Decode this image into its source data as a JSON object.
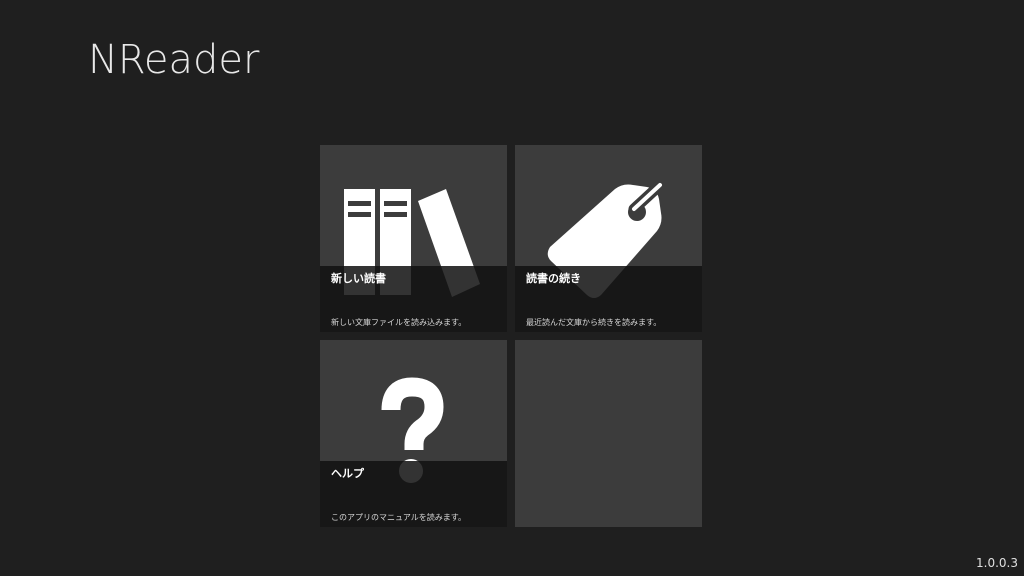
{
  "app": {
    "title": "NReader",
    "version": "1.0.0.3"
  },
  "tiles": [
    {
      "title": "新しい読書",
      "description": "新しい文庫ファイルを読み込みます。",
      "icon": "books-icon"
    },
    {
      "title": "読書の続き",
      "description": "最近読んだ文庫から続きを読みます。",
      "icon": "bookmark-tag-icon"
    },
    {
      "title": "ヘルプ",
      "description": "このアプリのマニュアルを読みます。",
      "icon": "question-mark-icon"
    }
  ],
  "colors": {
    "background": "#1f1f1f",
    "tile": "#3c3c3c",
    "caption": "#121212",
    "icon": "#ffffff"
  }
}
